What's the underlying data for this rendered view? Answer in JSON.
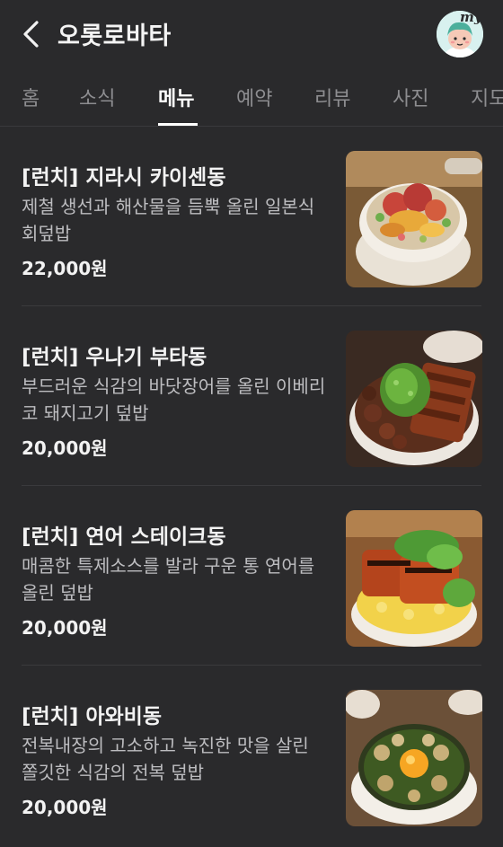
{
  "header": {
    "title": "오롯로바타",
    "avatar_badge": "my"
  },
  "tabs": [
    {
      "label": "홈"
    },
    {
      "label": "소식"
    },
    {
      "label": "메뉴",
      "active": true
    },
    {
      "label": "예약"
    },
    {
      "label": "리뷰"
    },
    {
      "label": "사진"
    },
    {
      "label": "지도"
    }
  ],
  "menu": [
    {
      "name": "[런치] 지라시 카이센동",
      "description": "제철 생선과 해산물을 듬뿍 올린 일본식 회덮밥",
      "price": "22,000원",
      "image": "chirashi-kaisendon-photo"
    },
    {
      "name": "[런치] 우나기 부타동",
      "description": "부드러운 식감의 바닷장어를 올린 이베리코 돼지고기 덮밥",
      "price": "20,000원",
      "image": "unagi-butadon-photo"
    },
    {
      "name": "[런치] 연어 스테이크동",
      "description": "매콤한 특제소스를 발라 구운 통 연어를 올린 덮밥",
      "price": "20,000원",
      "image": "salmon-steak-don-photo"
    },
    {
      "name": "[런치] 아와비동",
      "description": "전복내장의 고소하고 녹진한 맛을 살린 쫄깃한 식감의 전복 덮밥",
      "price": "20,000원",
      "image": "awabi-don-photo"
    }
  ]
}
